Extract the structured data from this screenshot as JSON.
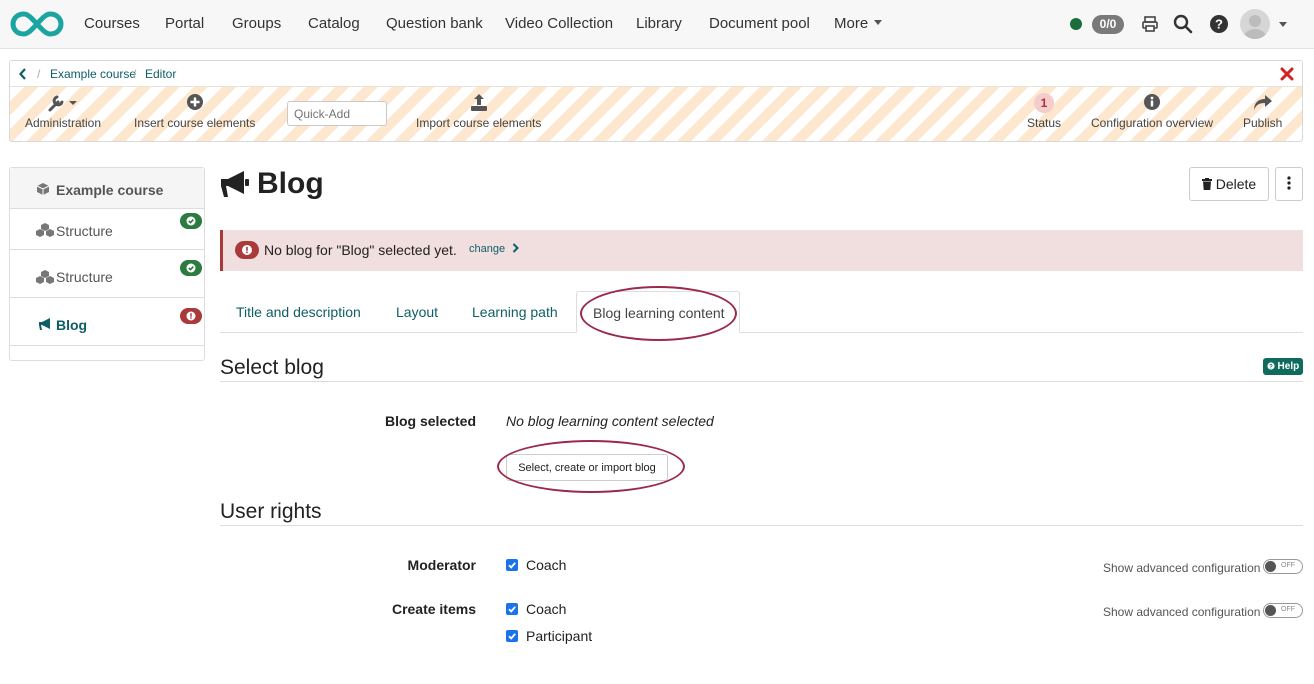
{
  "nav": {
    "items": [
      "Courses",
      "Portal",
      "Groups",
      "Catalog",
      "Question bank",
      "Video Collection",
      "Library",
      "Document pool",
      "More"
    ],
    "count_badge": "0/0"
  },
  "breadcrumb": {
    "items": [
      "Example course",
      "Editor"
    ]
  },
  "toolbar": {
    "administration": "Administration",
    "insert_elements": "Insert course elements",
    "quick_add_placeholder": "Quick-Add",
    "import_elements": "Import course elements",
    "status": "Status",
    "status_count": "1",
    "config_overview": "Configuration overview",
    "publish": "Publish"
  },
  "tree": {
    "title": "Example course",
    "items": [
      {
        "label": "Structure",
        "status": "ok"
      },
      {
        "label": "Structure",
        "status": "ok"
      },
      {
        "label": "Blog",
        "status": "error"
      }
    ]
  },
  "main": {
    "title": "Blog",
    "delete_label": "Delete",
    "alert_text": "No blog for \"Blog\" selected yet.",
    "alert_link": "change",
    "tabs": [
      "Title and description",
      "Layout",
      "Learning path",
      "Blog learning content"
    ],
    "active_tab": "Blog learning content",
    "help_label": "Help"
  },
  "select_blog": {
    "heading": "Select blog",
    "label": "Blog selected",
    "value": "No blog learning content selected",
    "button": "Select, create or import blog"
  },
  "user_rights": {
    "heading": "User rights",
    "moderator_label": "Moderator",
    "moderator_options": [
      "Coach"
    ],
    "create_label": "Create items",
    "create_options": [
      "Coach",
      "Participant"
    ],
    "advanced_label": "Show advanced configuration",
    "toggle_text": "OFF"
  },
  "colors": {
    "accent": "#0e5e66",
    "logo": "#1aa5a0",
    "ok": "#2b7a3f",
    "error": "#a93a3a",
    "highlight_ring": "#9b2a4a"
  }
}
